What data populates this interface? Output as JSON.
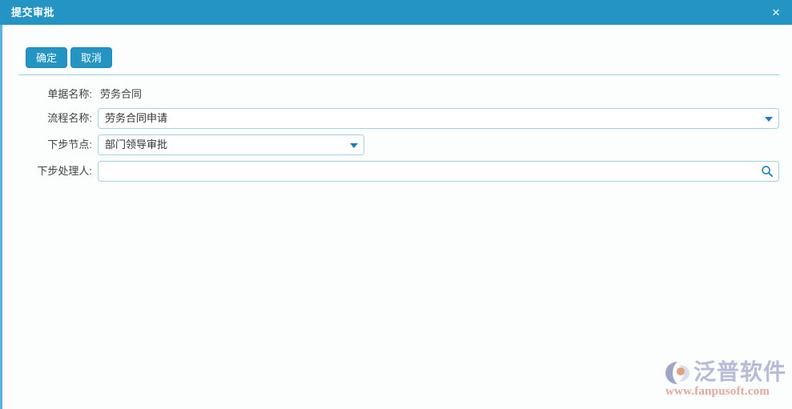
{
  "window": {
    "title": "提交审批",
    "close_label": "×",
    "accent_color": "#2494c4",
    "border_color": "#5cb3dc",
    "body_background": "#fcfdfd"
  },
  "toolbar": {
    "confirm_label": "确定",
    "cancel_label": "取消"
  },
  "form": {
    "rows": [
      {
        "label": "单据名称:",
        "value": "劳务合同",
        "type": "static"
      },
      {
        "label": "流程名称:",
        "value": "劳务合同申请",
        "placeholder": "",
        "type": "select"
      },
      {
        "label": "下步节点:",
        "value": "部门领导审批",
        "placeholder": "",
        "type": "select"
      },
      {
        "label": "下步处理人:",
        "value": "",
        "placeholder": "",
        "type": "search"
      }
    ]
  },
  "icons": {
    "caret_down": "chevron-down-icon",
    "search": "search-icon",
    "close": "close-icon"
  },
  "watermark": {
    "brand": "泛普软件",
    "url": "www.fanpusoft.com",
    "brand_color": "#b6bcd6",
    "url_color": "#e0a89c"
  }
}
